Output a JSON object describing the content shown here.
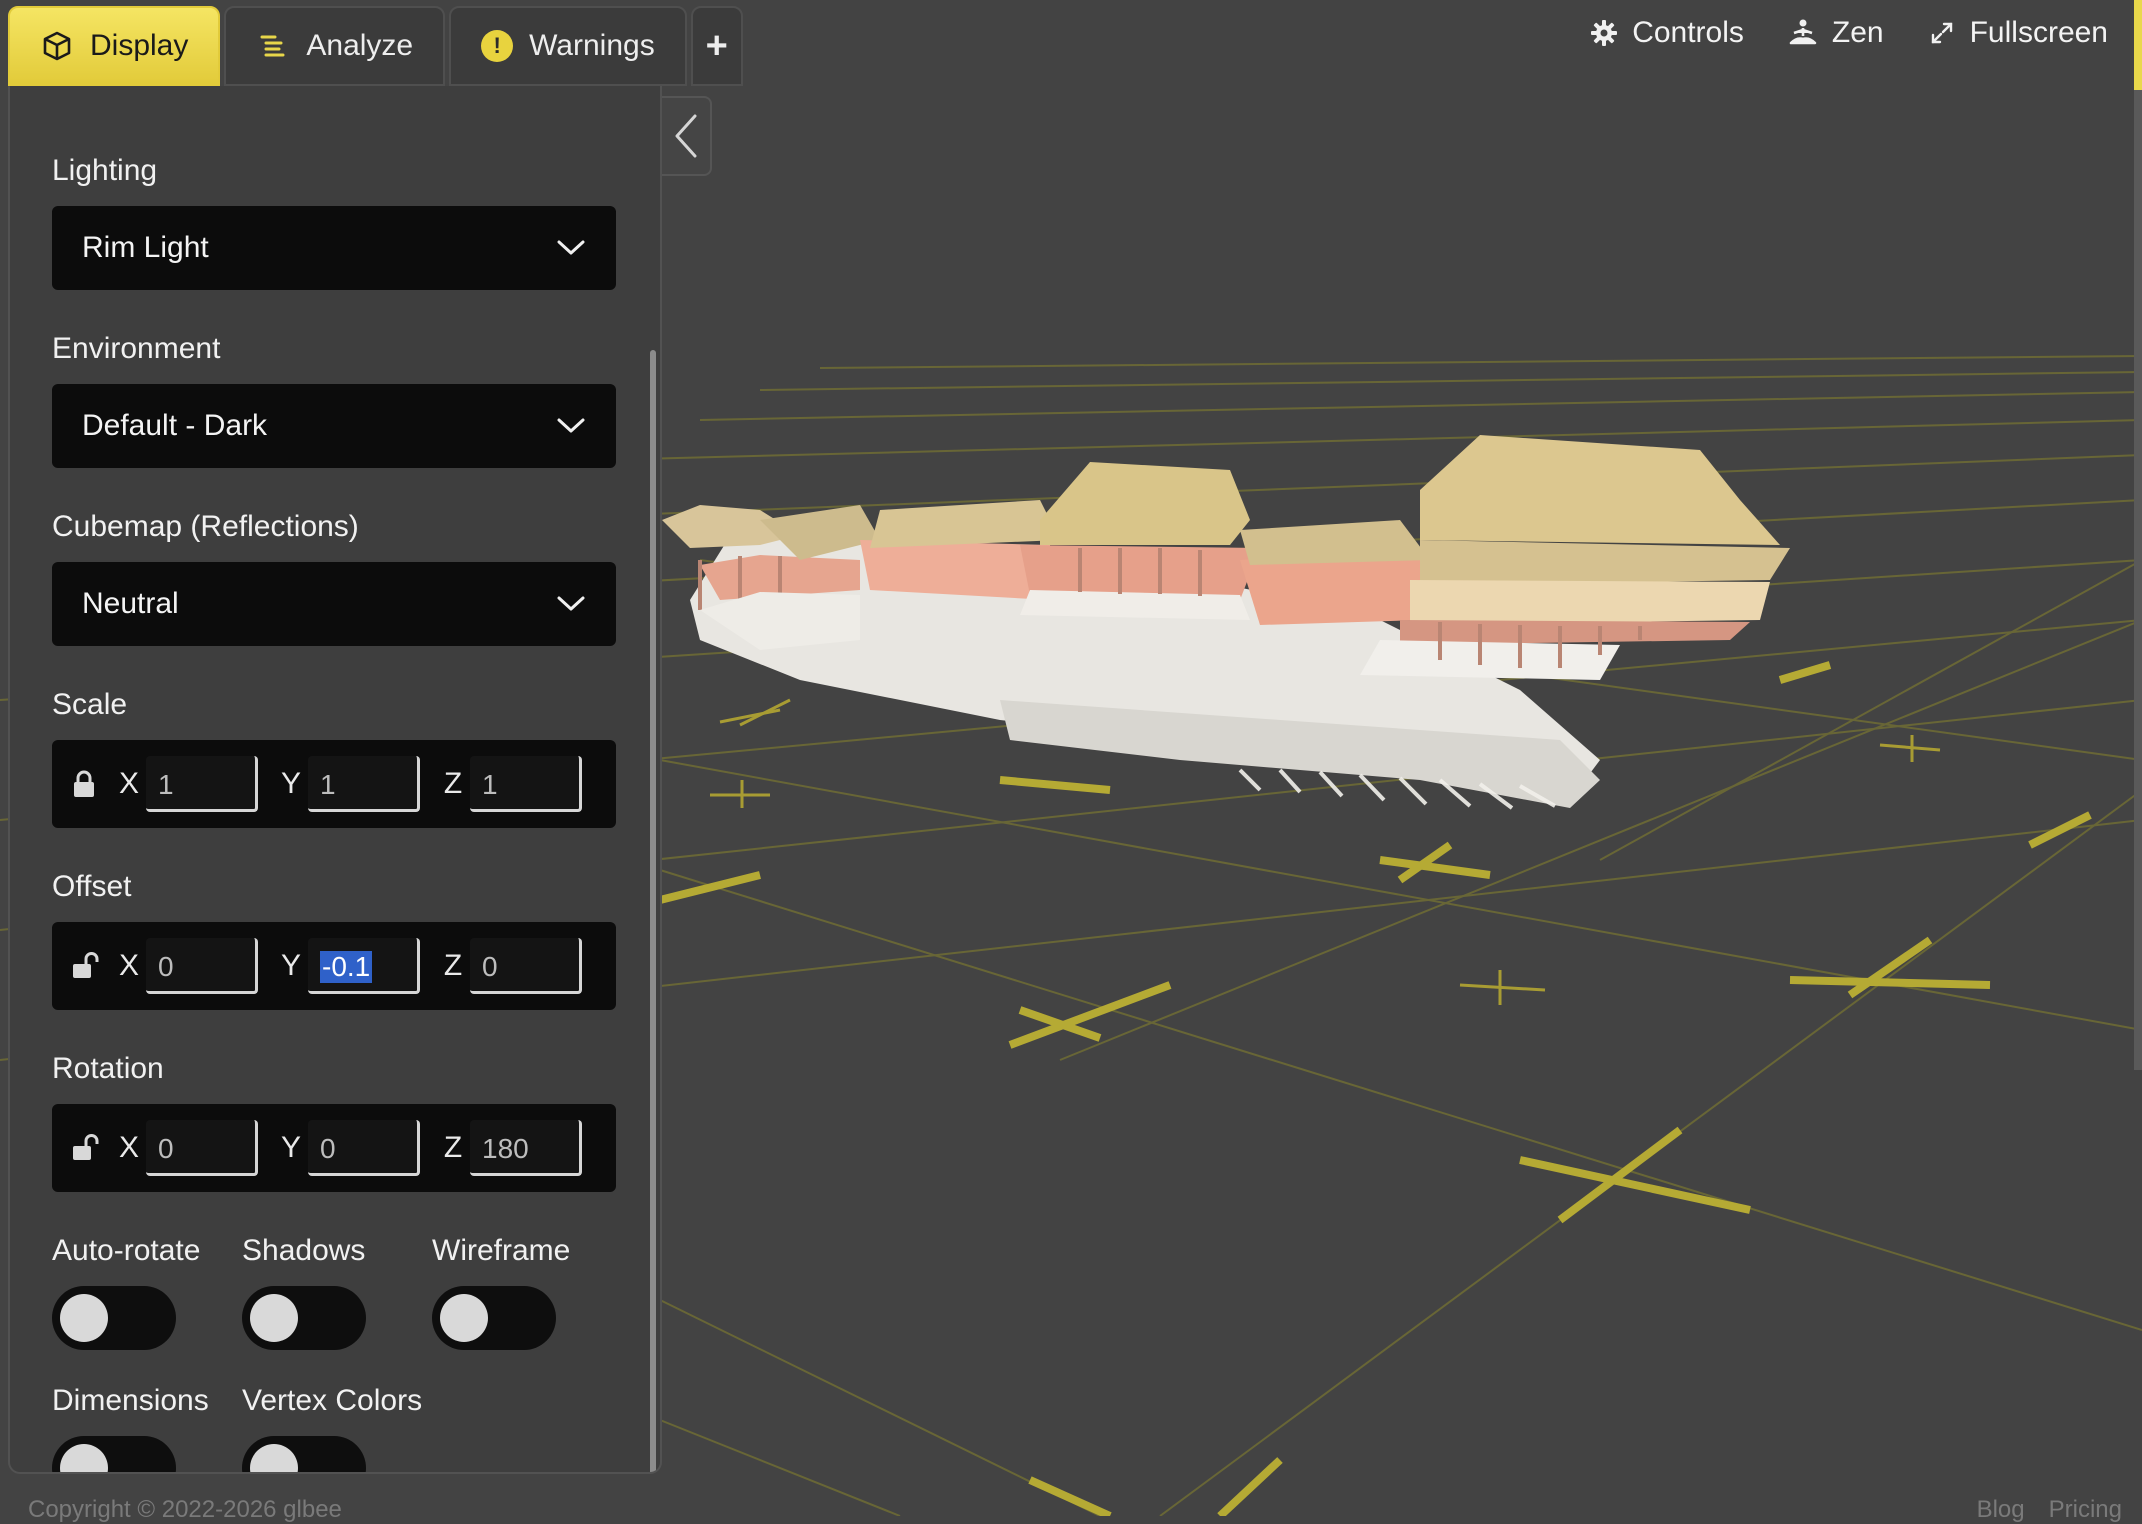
{
  "tabs": [
    {
      "label": "Display",
      "icon": "cube-icon",
      "active": true
    },
    {
      "label": "Analyze",
      "icon": "list-icon",
      "active": false
    },
    {
      "label": "Warnings",
      "icon": "warning-icon",
      "active": false
    }
  ],
  "warnings_badge": "!",
  "add_tab_label": "+",
  "toolbar": {
    "controls_label": "Controls",
    "zen_label": "Zen",
    "fullscreen_label": "Fullscreen"
  },
  "panel": {
    "lighting": {
      "label": "Lighting",
      "value": "Rim Light"
    },
    "environment": {
      "label": "Environment",
      "value": "Default - Dark"
    },
    "cubemap": {
      "label": "Cubemap (Reflections)",
      "value": "Neutral"
    },
    "scale": {
      "label": "Scale",
      "locked": true,
      "x": "1",
      "y": "1",
      "z": "1"
    },
    "offset": {
      "label": "Offset",
      "locked": false,
      "x": "0",
      "y": "-0.1",
      "z": "0"
    },
    "rotation": {
      "label": "Rotation",
      "locked": false,
      "x": "0",
      "y": "0",
      "z": "180"
    },
    "axes": {
      "x": "X",
      "y": "Y",
      "z": "Z"
    },
    "toggles": {
      "auto_rotate": {
        "label": "Auto-rotate",
        "on": false
      },
      "shadows": {
        "label": "Shadows",
        "on": false
      },
      "wireframe": {
        "label": "Wireframe",
        "on": false
      },
      "dimensions": {
        "label": "Dimensions",
        "on": false
      },
      "vertex_colors": {
        "label": "Vertex Colors",
        "on": false
      }
    }
  },
  "footer": {
    "copyright": "Copyright © 2022-2026 glbee",
    "links": [
      "Blog",
      "Pricing"
    ]
  },
  "colors": {
    "accent": "#e9d84b",
    "grid": "#b5aa34",
    "viewport_bg": "#434343",
    "panel_bg": "#3e3e3e",
    "field_bg": "#0c0c0c",
    "selection": "#2f61c9"
  }
}
